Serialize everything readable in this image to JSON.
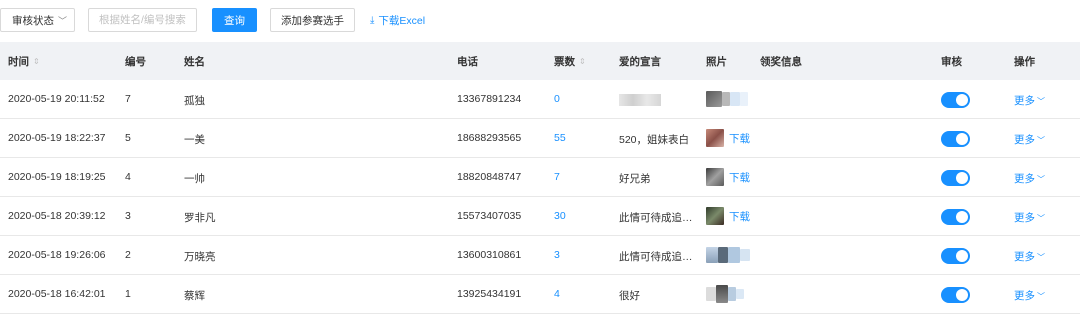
{
  "toolbar": {
    "status_select": "审核状态",
    "search_placeholder": "根据姓名/编号搜索",
    "query_label": "查询",
    "add_label": "添加参赛选手",
    "download_label": "下载Excel"
  },
  "table": {
    "headers": {
      "time": "时间",
      "number": "编号",
      "name": "姓名",
      "phone": "电话",
      "votes": "票数",
      "declaration": "爱的宣言",
      "photo": "照片",
      "award": "领奖信息",
      "audit": "审核",
      "operation": "操作"
    },
    "rows": [
      {
        "time": "2020-05-19 20:11:52",
        "number": "7",
        "name": "孤独",
        "phone": "13367891234",
        "votes": "0",
        "declaration": "",
        "photo_download": "",
        "more": "更多"
      },
      {
        "time": "2020-05-19 18:22:37",
        "number": "5",
        "name": "一美",
        "phone": "18688293565",
        "votes": "55",
        "declaration": "520，姐妹表白",
        "photo_download": "下载",
        "more": "更多"
      },
      {
        "time": "2020-05-19 18:19:25",
        "number": "4",
        "name": "一帅",
        "phone": "18820848747",
        "votes": "7",
        "declaration": "好兄弟",
        "photo_download": "下载",
        "more": "更多"
      },
      {
        "time": "2020-05-18 20:39:12",
        "number": "3",
        "name": "罗非凡",
        "phone": "15573407035",
        "votes": "30",
        "declaration": "此情可待成追…",
        "photo_download": "下载",
        "more": "更多"
      },
      {
        "time": "2020-05-18 19:26:06",
        "number": "2",
        "name": "万晓亮",
        "phone": "13600310861",
        "votes": "3",
        "declaration": "此情可待成追…",
        "photo_download": "",
        "more": "更多"
      },
      {
        "time": "2020-05-18 16:42:01",
        "number": "1",
        "name": "蔡辉",
        "phone": "13925434191",
        "votes": "4",
        "declaration": "很好",
        "photo_download": "",
        "more": "更多"
      }
    ]
  },
  "colors": {
    "accent": "#1890ff",
    "header_bg": "#f0f2f5",
    "border": "#e8e8e8"
  },
  "icons": {
    "select_chevron": "chevron-down-icon",
    "download": "download-icon",
    "sort": "sort-icon",
    "more_chevron": "chevron-down-icon"
  }
}
